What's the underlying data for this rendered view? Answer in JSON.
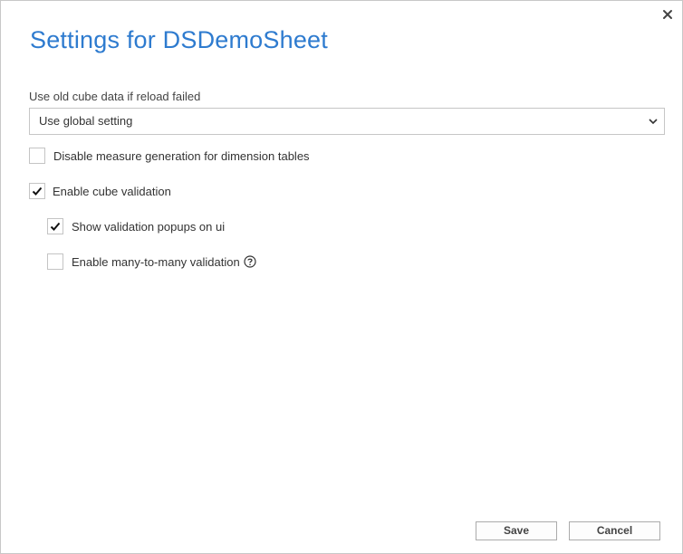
{
  "dialog": {
    "title": "Settings for DSDemoSheet",
    "close_icon": "close-icon"
  },
  "reload_setting": {
    "label": "Use old cube data if reload failed",
    "selected": "Use global setting",
    "chevron_icon": "chevron-down-icon"
  },
  "options": {
    "disable_measure_generation": {
      "label": "Disable measure generation for dimension tables",
      "checked": false
    },
    "enable_cube_validation": {
      "label": "Enable cube validation",
      "checked": true
    },
    "show_validation_popups": {
      "label": "Show validation popups on ui",
      "checked": true
    },
    "enable_many_to_many": {
      "label": "Enable many-to-many validation",
      "checked": false,
      "help_icon": "help-icon"
    }
  },
  "buttons": {
    "save": "Save",
    "cancel": "Cancel"
  },
  "colors": {
    "title": "#2e7bcf",
    "border": "#c6c6c6",
    "text": "#333333"
  }
}
